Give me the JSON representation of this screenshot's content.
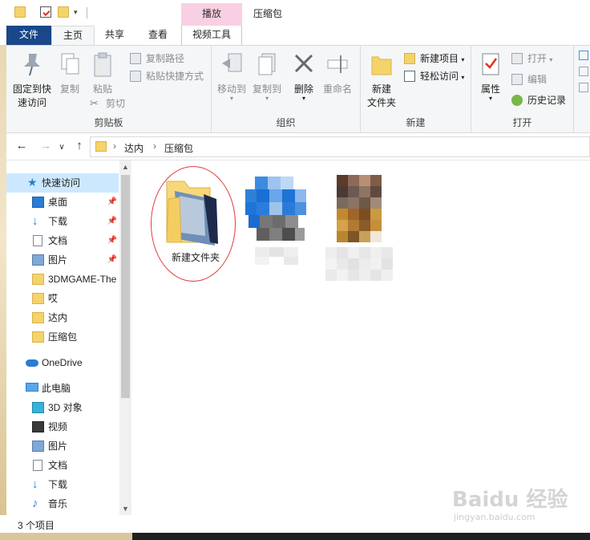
{
  "title_bar": {
    "context_tab": "播放",
    "window_title": "压缩包"
  },
  "tabs": [
    "文件",
    "主页",
    "共享",
    "查看",
    "视频工具"
  ],
  "ribbon": {
    "clipboard": {
      "pin_quick_access": "固定到快\n速访问",
      "copy": "复制",
      "paste": "粘贴",
      "copy_path": "复制路径",
      "paste_shortcut": "粘贴快捷方式",
      "cut": "剪切",
      "label": "剪贴板"
    },
    "organize": {
      "move_to": "移动到",
      "copy_to": "复制到",
      "delete": "删除",
      "rename": "重命名",
      "label": "组织"
    },
    "new": {
      "new_folder": "新建\n文件夹",
      "new_item": "新建项目",
      "easy_access": "轻松访问",
      "label": "新建"
    },
    "open": {
      "properties": "属性",
      "open": "打开",
      "edit": "编辑",
      "history": "历史记录",
      "label": "打开"
    }
  },
  "address": {
    "crumbs": [
      "达内",
      "压缩包"
    ]
  },
  "nav_pane": {
    "items": [
      {
        "label": "快速访问",
        "icon": "star-icon"
      },
      {
        "label": "桌面",
        "icon": "desktop-icon"
      },
      {
        "label": "下载",
        "icon": "download-icon"
      },
      {
        "label": "文档",
        "icon": "document-icon"
      },
      {
        "label": "图片",
        "icon": "picture-icon"
      },
      {
        "label": "3DMGAME-The",
        "icon": "folder-icon"
      },
      {
        "label": "哎",
        "icon": "folder-icon"
      },
      {
        "label": "达内",
        "icon": "folder-icon"
      },
      {
        "label": "压缩包",
        "icon": "folder-icon"
      },
      {
        "label": "OneDrive",
        "icon": "cloud-icon"
      },
      {
        "label": "此电脑",
        "icon": "computer-icon"
      },
      {
        "label": "3D 对象",
        "icon": "3d-object-icon"
      },
      {
        "label": "视频",
        "icon": "video-icon"
      },
      {
        "label": "图片",
        "icon": "picture-icon"
      },
      {
        "label": "文档",
        "icon": "document-icon"
      },
      {
        "label": "下载",
        "icon": "download-icon"
      },
      {
        "label": "音乐",
        "icon": "music-icon"
      }
    ]
  },
  "files": [
    {
      "name": "新建文件夹",
      "icon": "folder-with-content-icon"
    },
    {
      "name": "",
      "icon": "blurred-file-icon"
    },
    {
      "name": "",
      "icon": "blurred-image-icon"
    }
  ],
  "status": {
    "item_count": "3 个项目"
  },
  "watermark": {
    "logo": "Baidu 经验",
    "sub": "jingyan.baidu.com"
  },
  "colors": {
    "file_tab": "#19478a",
    "context_tab": "#f9cfe3",
    "selected": "#cce8ff",
    "highlight": "#e23b3b"
  }
}
